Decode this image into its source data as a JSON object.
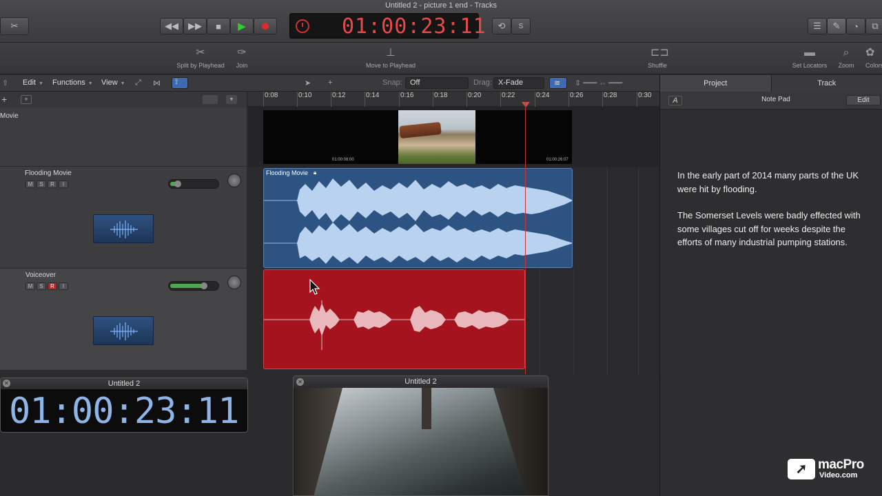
{
  "window": {
    "title": "Untitled 2 - picture 1 end - Tracks"
  },
  "transport": {
    "time_display": "01:00:23:11",
    "rewind_icon": "rewind-icon",
    "forward_icon": "fast-forward-icon",
    "stop_icon": "stop-icon",
    "play_icon": "play-icon",
    "record_icon": "record-icon",
    "cycle_icon": "cycle-icon",
    "metronome_label": "S"
  },
  "toolbar": {
    "split_label": "Split by Playhead",
    "join_label": "Join",
    "move_label": "Move to Playhead",
    "shuffle_label": "Shuffle",
    "locators_label": "Set Locators",
    "zoom_label": "Zoom",
    "colors_label": "Colors"
  },
  "menubar": {
    "edit": "Edit",
    "functions": "Functions",
    "view": "View",
    "snap_label": "Snap:",
    "snap_value": "Off",
    "drag_label": "Drag:",
    "drag_value": "X-Fade"
  },
  "ruler": {
    "ticks": [
      "0:08",
      "0:10",
      "0:12",
      "0:14",
      "0:16",
      "0:18",
      "0:20",
      "0:22",
      "0:24",
      "0:26",
      "0:28",
      "0:30"
    ]
  },
  "tracks": [
    {
      "name": "Movie"
    },
    {
      "name": "Flooding Movie",
      "buttons": [
        "M",
        "S",
        "R",
        "I"
      ],
      "volume": 0.15
    },
    {
      "name": "Voiceover",
      "buttons": [
        "M",
        "S",
        "R",
        "I"
      ],
      "volume": 0.68
    }
  ],
  "regions": {
    "movie_tc_start": "01:00:08:00",
    "movie_tc_end": "01:00:26:07",
    "flooding_label": "Flooding Movie"
  },
  "right_panel": {
    "tabs": [
      "Project",
      "Track"
    ],
    "notepad_title": "Note Pad",
    "edit_button": "Edit",
    "paragraphs": [
      "In the early part of 2014 many parts of the UK were hit by flooding.",
      "The Somerset Levels were badly effected with some villages cut off for weeks despite the efforts of many industrial pumping stations."
    ]
  },
  "lcd_window": {
    "title": "Untitled 2",
    "time": "01:00:23:11"
  },
  "video_window": {
    "title": "Untitled 2"
  },
  "logo": {
    "line1": "macPro",
    "line2": "Video.com"
  }
}
